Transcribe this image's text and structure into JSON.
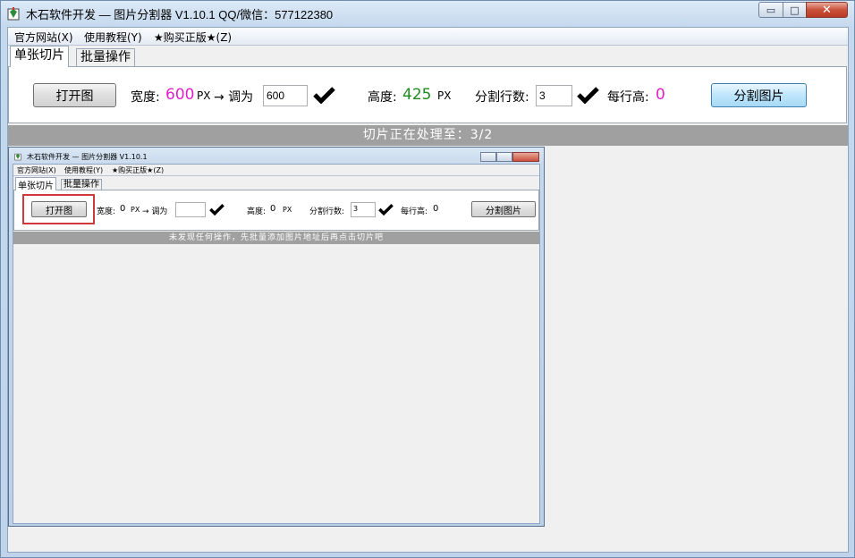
{
  "window": {
    "title": "木石软件开发 — 图片分割器 V1.10.1    QQ/微信：577122380",
    "min_glyph": "▭",
    "max_glyph": "□",
    "close_glyph": "✕"
  },
  "menu": [
    "官方网站(X)",
    "使用教程(Y)",
    "★购买正版★(Z)"
  ],
  "tabs": {
    "single": "单张切片",
    "batch": "批量操作"
  },
  "toolbar": {
    "open_button": "打开图",
    "width_label": "宽度:",
    "width_value": "600",
    "px1": "PX",
    "arrow_label": "→ 调为",
    "resize_value": "600",
    "height_label": "高度:",
    "height_value": "425",
    "px2": "PX",
    "rows_label": "分割行数:",
    "rows_value": "3",
    "row_height_label": "每行高:",
    "row_height_value": "0",
    "split_button": "分割图片"
  },
  "status": "切片正在处理至：3/2",
  "preview": {
    "title": "木石软件开发 — 图片分割器 V1.10.1",
    "menu": [
      "官方网站(X)",
      "使用教程(Y)",
      "★购买正版★(Z)"
    ],
    "tabs": {
      "single": "单张切片",
      "batch": "批量操作"
    },
    "open_button": "打开图",
    "width_label": "宽度:",
    "width_value": "0",
    "px1": "PX",
    "arrow_label": "→ 调为",
    "resize_value": "",
    "height_label": "高度:",
    "height_value": "0",
    "px2": "PX",
    "rows_label": "分割行数:",
    "rows_value": "3",
    "row_height_label": "每行高:",
    "row_height_value": "0",
    "split_button": "分割图片",
    "status": "未发现任何操作，先批量添加图片地址后再点击切片吧"
  },
  "colors": {
    "magenta_value": "#e020c8",
    "green_value": "#1f8a1f",
    "status_bg": "#a0a0a0"
  }
}
